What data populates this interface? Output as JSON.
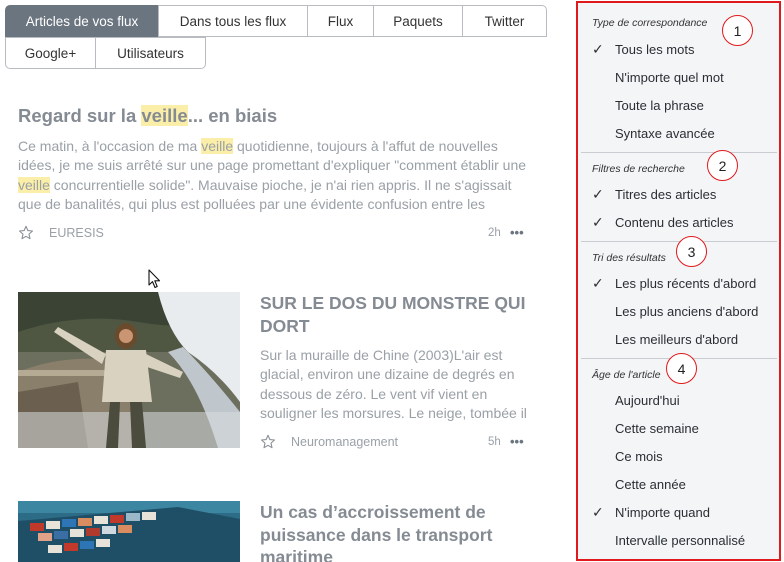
{
  "tabs": [
    {
      "label": "Articles de vos flux",
      "active": true
    },
    {
      "label": "Dans tous les flux",
      "active": false
    },
    {
      "label": "Flux",
      "active": false
    },
    {
      "label": "Paquets",
      "active": false
    },
    {
      "label": "Twitter",
      "active": false
    },
    {
      "label": "Google+",
      "active": false
    },
    {
      "label": "Utilisateurs",
      "active": false
    }
  ],
  "articles": [
    {
      "title_before": "Regard sur la ",
      "title_highlight": "veille",
      "title_after": "... en biais",
      "excerpt": {
        "p1": "Ce matin, à l'occasion de ma ",
        "h1": "veille",
        "p2": " quotidienne, toujours à l'affut de nouvelles idées, je me suis arrêté sur une page promettant d'expliquer \"comment établir une ",
        "h2": "veille",
        "p3": " concurrentielle solide\". Mauvaise pioche, je n'ai rien appris. Il ne s'agissait que de banalités, qui plus est polluées par une évidente confusion entre les"
      },
      "source": "EURESIS",
      "time": "2h",
      "more": "•••"
    },
    {
      "title": "SUR LE DOS DU MONSTRE QUI DORT",
      "excerpt": "Sur la muraille de Chine (2003)L'air est glacial, environ une dizaine de degrés en dessous de zéro. Le vent vif vient en souligner les morsures. Le neige, tombée il",
      "source": "Neuromanagement",
      "time": "5h",
      "more": "•••"
    },
    {
      "title": "Un cas d’accroissement de puissance dans le transport maritime"
    }
  ],
  "filter_panel": {
    "sections": [
      {
        "title": "Type de correspondance",
        "badge": "1",
        "options": [
          {
            "label": "Tous les mots",
            "checked": true
          },
          {
            "label": "N'importe quel mot",
            "checked": false
          },
          {
            "label": "Toute la phrase",
            "checked": false
          },
          {
            "label": "Syntaxe avancée",
            "checked": false
          }
        ]
      },
      {
        "title": "Filtres de recherche",
        "badge": "2",
        "options": [
          {
            "label": "Titres des articles",
            "checked": true
          },
          {
            "label": "Contenu des articles",
            "checked": true
          }
        ]
      },
      {
        "title": "Tri des résultats",
        "badge": "3",
        "options": [
          {
            "label": "Les plus récents d'abord",
            "checked": true
          },
          {
            "label": "Les plus anciens d'abord",
            "checked": false
          },
          {
            "label": "Les meilleurs d'abord",
            "checked": false
          }
        ]
      },
      {
        "title": "Âge de l'article",
        "badge": "4",
        "options": [
          {
            "label": "Aujourd'hui",
            "checked": false
          },
          {
            "label": "Cette semaine",
            "checked": false
          },
          {
            "label": "Ce mois",
            "checked": false
          },
          {
            "label": "Cette année",
            "checked": false
          },
          {
            "label": "N'importe quand",
            "checked": true
          },
          {
            "label": "Intervalle personnalisé",
            "checked": false
          }
        ]
      }
    ],
    "check_glyph": "✓"
  },
  "colors": {
    "active_tab": "#6b7580",
    "highlight": "#fbeea9",
    "annotation_red": "#e0191c"
  }
}
